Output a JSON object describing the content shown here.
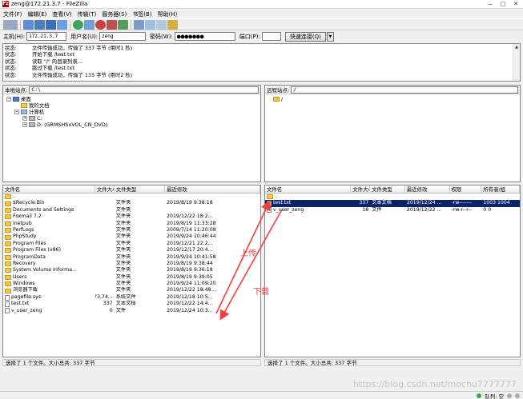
{
  "window": {
    "title": "zeng@172.21.3.7 - FileZilla",
    "app_icon": "filezilla-icon",
    "controls": [
      "—",
      "□",
      "✕"
    ]
  },
  "menu": [
    "文件(F)",
    "编辑(E)",
    "查看(V)",
    "传输(T)",
    "服务器(S)",
    "书签(B)",
    "帮助(H)"
  ],
  "quickconnect": {
    "host_label": "主机(H):",
    "host_value": "172.21.3.7",
    "user_label": "用户名(U):",
    "user_value": "zeng",
    "pass_label": "密码(W):",
    "pass_value": "●●●●●●●",
    "port_label": "端口(P):",
    "port_value": "",
    "connect_label": "快速连接(Q)",
    "dropdown": "▼"
  },
  "log": [
    {
      "label": "状态:",
      "text": "文件传输成功，传输了 337 字节 (用时1 秒)"
    },
    {
      "label": "状态:",
      "text": "开始下载 /test.txt"
    },
    {
      "label": "状态:",
      "text": "读取 \"/\" 的目录列表..."
    },
    {
      "label": "状态:",
      "text": "跳过下载 /test.txt"
    },
    {
      "label": "状态:",
      "text": "文件传输成功，传输了 135 字节 (用时2 秒)"
    }
  ],
  "local": {
    "site_label": "本地站点:",
    "path": "C:\\",
    "tree": [
      {
        "label": "桌面",
        "icon": "desktop-icon",
        "level": 0,
        "exp": "−"
      },
      {
        "label": "我的文档",
        "icon": "folder-icon",
        "level": 1,
        "exp": ""
      },
      {
        "label": "计算机",
        "icon": "computer-icon",
        "level": 1,
        "exp": "−"
      },
      {
        "label": "C:",
        "icon": "drive-icon",
        "level": 2,
        "exp": "+"
      },
      {
        "label": "D: (GRMSHSxVOL_CN_DVD)",
        "icon": "drive-icon",
        "level": 2,
        "exp": "+"
      }
    ],
    "headers": {
      "name": "文件名",
      "size": "文件大小",
      "type": "文件类型",
      "date": "最近修改"
    },
    "files": [
      {
        "name": "..",
        "size": "",
        "type": "",
        "date": "",
        "icon": "folder"
      },
      {
        "name": "$Recycle.Bin",
        "size": "",
        "type": "文件夹",
        "date": "2019/8/19 9:38:18",
        "icon": "folder"
      },
      {
        "name": "Documents and Settings",
        "size": "",
        "type": "文件夹",
        "date": "",
        "icon": "folder"
      },
      {
        "name": "Foxmail 7.2",
        "size": "",
        "type": "文件夹",
        "date": "2019/12/22 18:2...",
        "icon": "folder"
      },
      {
        "name": "inetpub",
        "size": "",
        "type": "文件夹",
        "date": "2019/8/19 11:33:28",
        "icon": "folder"
      },
      {
        "name": "PerfLogs",
        "size": "",
        "type": "文件夹",
        "date": "2009/7/14 11:20:08",
        "icon": "folder"
      },
      {
        "name": "PhpStudy",
        "size": "",
        "type": "文件夹",
        "date": "2019/9/24 10:46:44",
        "icon": "folder"
      },
      {
        "name": "Program Files",
        "size": "",
        "type": "文件夹",
        "date": "2019/12/21 22:2...",
        "icon": "folder"
      },
      {
        "name": "Program Files (x86)",
        "size": "",
        "type": "文件夹",
        "date": "2019/12/17 20:4...",
        "icon": "folder"
      },
      {
        "name": "ProgramData",
        "size": "",
        "type": "文件夹",
        "date": "2019/9/24 10:41:58",
        "icon": "folder"
      },
      {
        "name": "Recovery",
        "size": "",
        "type": "文件夹",
        "date": "2019/8/19 9:38:44",
        "icon": "folder"
      },
      {
        "name": "System Volume Informa...",
        "size": "",
        "type": "文件夹",
        "date": "2019/8/19 9:36:18",
        "icon": "folder"
      },
      {
        "name": "Users",
        "size": "",
        "type": "文件夹",
        "date": "2019/8/19 9:39:05",
        "icon": "folder"
      },
      {
        "name": "Windows",
        "size": "",
        "type": "文件夹",
        "date": "2019/9/24 11:09:20",
        "icon": "folder"
      },
      {
        "name": "浏览器下载",
        "size": "",
        "type": "文件夹",
        "date": "2019/12/22 18:48...",
        "icon": "folder"
      },
      {
        "name": "pagefile.sys",
        "size": "1,073,74...",
        "type": "系统文件",
        "date": "2019/12/18 10:5...",
        "icon": "file"
      },
      {
        "name": "test.txt",
        "size": "337",
        "type": "文本文档",
        "date": "2019/12/22 14:4...",
        "icon": "file"
      },
      {
        "name": "v_user_zeng",
        "size": "0",
        "type": "文件",
        "date": "2019/12/24 10:3...",
        "icon": "file"
      }
    ],
    "status": "选择了 1 个文件。大小总共: 337 字节"
  },
  "remote": {
    "site_label": "远程站点:",
    "path": "/",
    "tree_root": "/",
    "headers": {
      "name": "文件名",
      "size": "文件大小",
      "type": "文件类型",
      "date": "最近修改",
      "perm": "权限",
      "owner": "所有者/组"
    },
    "files": [
      {
        "name": "..",
        "size": "",
        "type": "",
        "date": "",
        "perm": "",
        "owner": "",
        "icon": "folder",
        "selected": false
      },
      {
        "name": "test.txt",
        "size": "337",
        "type": "文本文档",
        "date": "2019/12/24 ...",
        "perm": "-rw-------",
        "owner": "1003 1004",
        "icon": "file",
        "selected": true
      },
      {
        "name": "v_user_zeng",
        "size": "18",
        "type": "文件",
        "date": "2019/12/22 ...",
        "perm": "-rw-r--r--",
        "owner": "0 0",
        "icon": "file",
        "selected": false
      }
    ],
    "status": "选择了 1 个文件。大小总共: 337 字节"
  },
  "queue": {
    "label": "队列: 空"
  },
  "annotations": {
    "upload": "上传",
    "download": "下载",
    "color": "#ff3b3b"
  },
  "watermark": "https://blog.csdn.net/mochu7777777"
}
